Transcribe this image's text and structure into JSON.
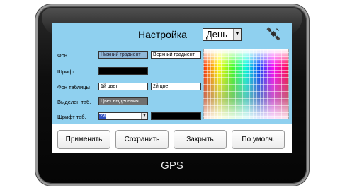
{
  "device": {
    "brand": "GPS"
  },
  "header": {
    "title": "Настройка",
    "mode_value": "День"
  },
  "settings": {
    "background": {
      "label": "Фон",
      "value1": "Нижний градиент",
      "value2": "Верхний градиент"
    },
    "font": {
      "label": "Шрифт"
    },
    "table_bg": {
      "label": "Фон таблицы",
      "value1": "1й цвет",
      "value2": "2й цвет"
    },
    "selection": {
      "label": "Выделен таб.",
      "value": "Цвет выделения"
    },
    "table_font": {
      "label": "Шрифт таб.",
      "value": "2й"
    }
  },
  "buttons": {
    "apply": "Применить",
    "save": "Сохранить",
    "close": "Закрыть",
    "defaults": "По умолч."
  },
  "colors": {
    "screen_bg": "#8fd0ef",
    "field_blue": "#8fb8d8",
    "field_gray": "#707070",
    "field_black": "#000000"
  }
}
